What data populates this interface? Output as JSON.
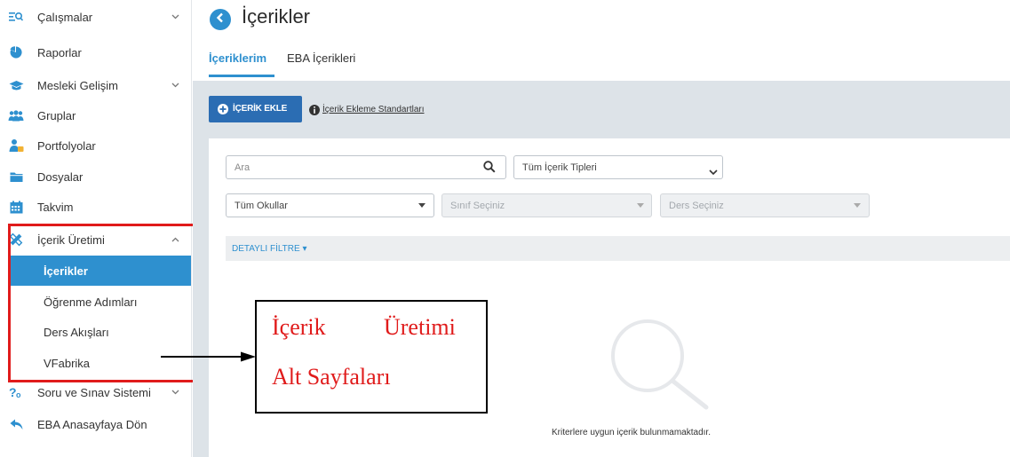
{
  "sidebar": {
    "items": [
      {
        "label": "Çalışmalar",
        "icon": "list-search-icon",
        "has_chevron": true
      },
      {
        "label": "Raporlar",
        "icon": "pie-chart-icon",
        "has_chevron": false
      },
      {
        "label": "Mesleki Gelişim",
        "icon": "graduation-cap-icon",
        "has_chevron": true
      },
      {
        "label": "Gruplar",
        "icon": "users-icon",
        "has_chevron": false
      },
      {
        "label": "Portfolyolar",
        "icon": "user-portfolio-icon",
        "has_chevron": false
      },
      {
        "label": "Dosyalar",
        "icon": "folder-icon",
        "has_chevron": false
      },
      {
        "label": "Takvim",
        "icon": "calendar-icon",
        "has_chevron": false
      },
      {
        "label": "İçerik Üretimi",
        "icon": "pencil-ruler-icon",
        "has_chevron": true,
        "expanded": true
      },
      {
        "label": "Soru ve Sınav Sistemi",
        "icon": "question-icon",
        "has_chevron": true
      },
      {
        "label": "EBA Anasayfaya Dön",
        "icon": "reply-arrow-icon",
        "has_chevron": false
      }
    ],
    "subitems": [
      {
        "label": "İçerikler",
        "active": true
      },
      {
        "label": "Öğrenme Adımları",
        "active": false
      },
      {
        "label": "Ders Akışları",
        "active": false
      },
      {
        "label": "VFabrika",
        "active": false
      }
    ]
  },
  "header": {
    "title": "İçerikler",
    "tabs": [
      {
        "label": "İçeriklerim",
        "active": true
      },
      {
        "label": "EBA İçerikleri",
        "active": false
      }
    ]
  },
  "toolbar": {
    "add_label": "İÇERİK EKLE",
    "standards_link": "İçerik Ekleme Standartları"
  },
  "filters": {
    "search_placeholder": "Ara",
    "content_type": "Tüm İçerik Tipleri",
    "school": "Tüm Okullar",
    "class": "Sınıf Seçiniz",
    "course": "Ders Seçiniz",
    "detail_filter": "DETAYLI FİLTRE ▾"
  },
  "empty_state": {
    "message": "Kriterlere uygun içerik bulunmamaktadır."
  },
  "annotation": {
    "word1": "İçerik",
    "word2": "Üretimi",
    "line2": "Alt Sayfaları"
  },
  "colors": {
    "accent": "#2e90cf",
    "button": "#2b6db3",
    "highlight": "#e01b1b",
    "background": "#dde3e8"
  }
}
